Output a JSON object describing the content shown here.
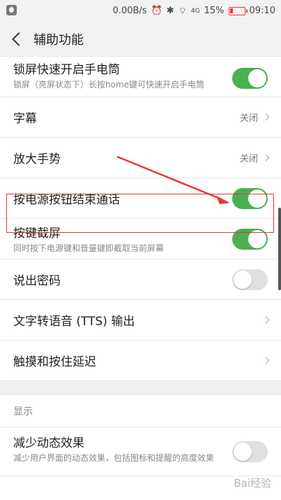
{
  "status_bar": {
    "speed": "0.00B/s",
    "battery_percent": "15%",
    "time": "09:10",
    "signal_label": "4G"
  },
  "header": {
    "title": "辅助功能"
  },
  "rows": [
    {
      "label": "锁屏快速开启手电筒",
      "sub": "锁屏（亮屏状态下）长按home键可快速开启手电筒",
      "toggle": true
    },
    {
      "label": "字幕",
      "value": "关闭"
    },
    {
      "label": "放大手势",
      "value": "关闭"
    },
    {
      "label": "按电源按钮结束通话",
      "toggle": true
    },
    {
      "label": "按键截屏",
      "sub": "同时按下电源键和音量键即截取当前屏幕",
      "toggle": true
    },
    {
      "label": "说出密码",
      "toggle": false
    },
    {
      "label": "文字转语音 (TTS) 输出"
    },
    {
      "label": "触摸和按住延迟"
    }
  ],
  "section_display": {
    "title": "显示"
  },
  "rows_display": [
    {
      "label": "减少动态效果",
      "sub": "减少用户界面的动态效果，包括图标和提醒的高度效果",
      "toggle": false
    }
  ],
  "watermark": "Bai经验",
  "colors": {
    "accent_green": "#4caf50",
    "highlight_red": "#e53935"
  }
}
